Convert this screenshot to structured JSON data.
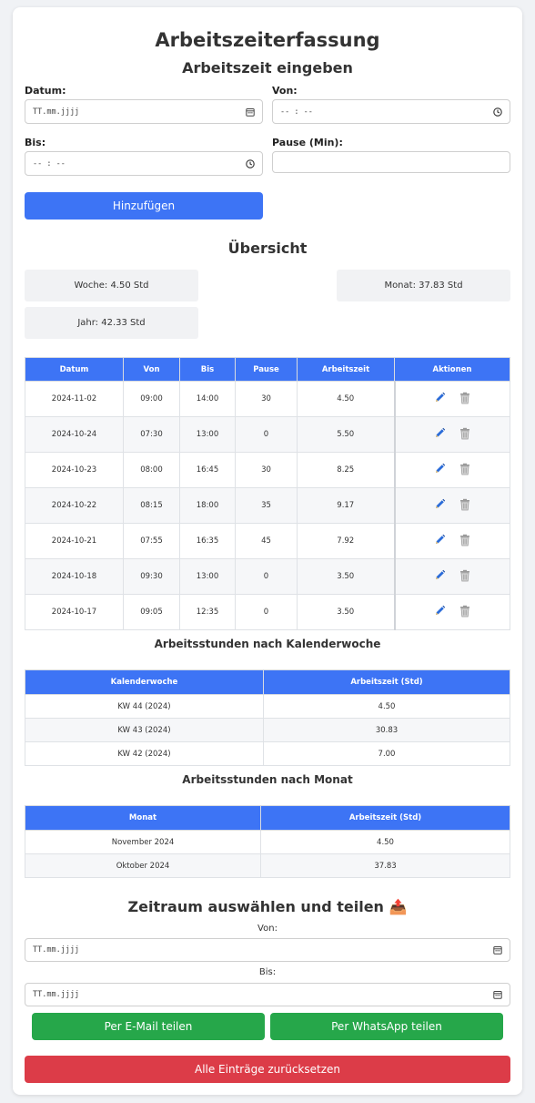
{
  "title": "Arbeitszeiterfassung",
  "entry": {
    "heading": "Arbeitszeit eingeben",
    "datum_label": "Datum:",
    "datum_placeholder": "TT.mm.jjjj",
    "von_label": "Von:",
    "von_placeholder": "-- : --",
    "bis_label": "Bis:",
    "bis_placeholder": "-- : --",
    "pause_label": "Pause (Min):",
    "pause_value": "",
    "add_button": "Hinzufügen"
  },
  "overview": {
    "heading": "Übersicht",
    "week": "Woche: 4.50 Std",
    "month": "Monat: 37.83 Std",
    "year": "Jahr: 42.33 Std"
  },
  "entries_table": {
    "headers": [
      "Datum",
      "Von",
      "Bis",
      "Pause",
      "Arbeitszeit",
      "Aktionen"
    ],
    "rows": [
      [
        "2024-11-02",
        "09:00",
        "14:00",
        "30",
        "4.50"
      ],
      [
        "2024-10-24",
        "07:30",
        "13:00",
        "0",
        "5.50"
      ],
      [
        "2024-10-23",
        "08:00",
        "16:45",
        "30",
        "8.25"
      ],
      [
        "2024-10-22",
        "08:15",
        "18:00",
        "35",
        "9.17"
      ],
      [
        "2024-10-21",
        "07:55",
        "16:35",
        "45",
        "7.92"
      ],
      [
        "2024-10-18",
        "09:30",
        "13:00",
        "0",
        "3.50"
      ],
      [
        "2024-10-17",
        "09:05",
        "12:35",
        "0",
        "3.50"
      ]
    ],
    "edit_icon": "pencil-icon",
    "delete_icon": "trash-icon"
  },
  "weekly": {
    "heading": "Arbeitsstunden nach Kalenderwoche",
    "headers": [
      "Kalenderwoche",
      "Arbeitszeit (Std)"
    ],
    "rows": [
      [
        "KW 44 (2024)",
        "4.50"
      ],
      [
        "KW 43 (2024)",
        "30.83"
      ],
      [
        "KW 42 (2024)",
        "7.00"
      ]
    ]
  },
  "monthly": {
    "heading": "Arbeitsstunden nach Monat",
    "headers": [
      "Monat",
      "Arbeitszeit (Std)"
    ],
    "rows": [
      [
        "November 2024",
        "4.50"
      ],
      [
        "Oktober 2024",
        "37.83"
      ]
    ]
  },
  "share": {
    "heading": "Zeitraum auswählen und teilen 📤",
    "von_label": "Von:",
    "von_placeholder": "TT.mm.jjjj",
    "bis_label": "Bis:",
    "bis_placeholder": "TT.mm.jjjj",
    "email_button": "Per E-Mail teilen",
    "whatsapp_button": "Per WhatsApp teilen",
    "reset_button": "Alle Einträge zurücksetzen"
  },
  "colors": {
    "primary": "#3d74f5",
    "share": "#26a74a",
    "danger": "#dc3c48",
    "edit_icon": "#2b6cd9"
  }
}
